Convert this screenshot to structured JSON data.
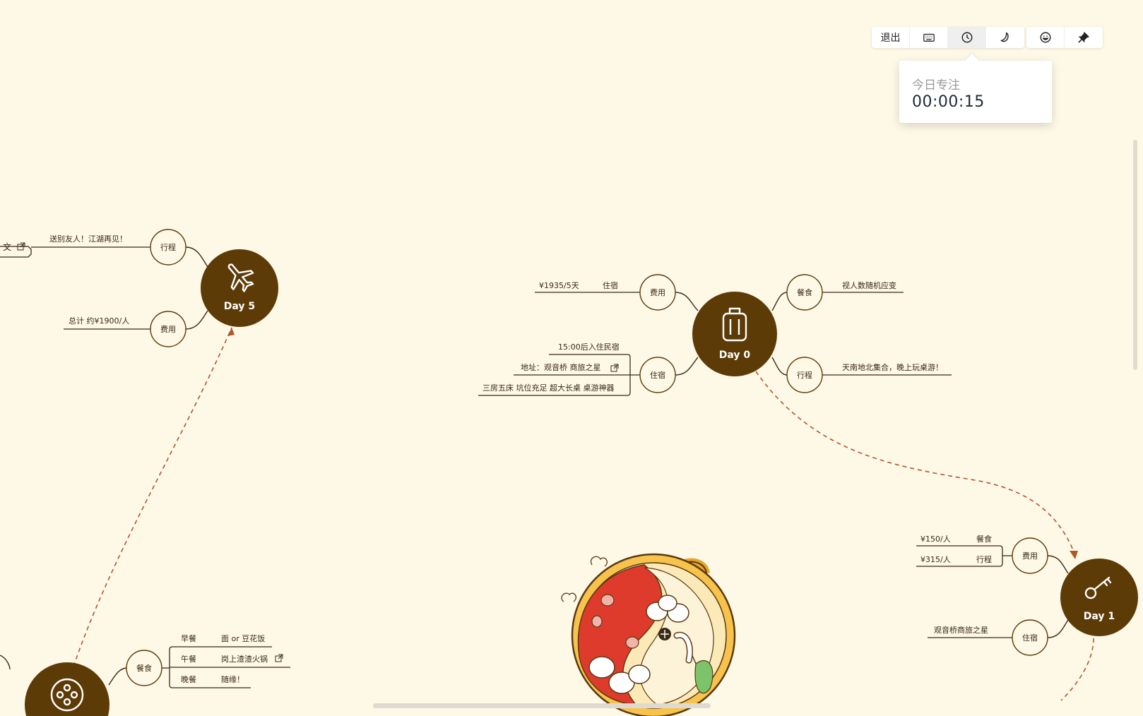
{
  "colors": {
    "accent": "#5c3b07",
    "line": "#3a2a14",
    "dashed": "#b2552b",
    "background": "#fef8e7"
  },
  "toolbar": {
    "exit_label": "退出",
    "keyboard_icon": "keyboard-icon",
    "clock_icon": "clock-icon",
    "moon_icon": "moon-icon",
    "emoji_icon": "emoji-icon",
    "pin_icon": "pin-icon"
  },
  "timer": {
    "label": "今日专注",
    "time": "00:00:15"
  },
  "day0": {
    "title": "Day 0",
    "icon": "suitcase-icon",
    "fee_label": "费用",
    "fee_item_label": "住宿",
    "fee_item_value": "¥1935/5天",
    "stay_label": "住宿",
    "stay_items": [
      "15:00后入住民宿",
      "地址：观音桥 商旅之星",
      "三房五床 坑位充足 超大长桌 桌游神器"
    ],
    "meal_label": "餐食",
    "meal_note": "视人数随机应变",
    "trip_label": "行程",
    "trip_note": "天南地北集合，晚上玩桌游！"
  },
  "day5": {
    "title": "Day 5",
    "icon": "airplane-icon",
    "trip_label": "行程",
    "trip_note": "送别友人！江湖再见！",
    "doc_stub": "文",
    "fee_label": "费用",
    "fee_note": "总计 约¥1900/人"
  },
  "day1": {
    "title": "Day 1",
    "icon": "key-icon",
    "fee_label": "费用",
    "fee_items": [
      {
        "label": "餐食",
        "value": "¥150/人"
      },
      {
        "label": "行程",
        "value": "¥315/人"
      }
    ],
    "stay_label": "住宿",
    "stay_note": "观音桥商旅之星"
  },
  "meal_node": {
    "label": "餐食",
    "icon": "film-reel-icon",
    "rows": [
      {
        "meal": "早餐",
        "food": "面 or 豆花饭"
      },
      {
        "meal": "午餐",
        "food": "岗上渣渣火锅"
      },
      {
        "meal": "晚餐",
        "food": "随缘！"
      }
    ]
  },
  "illustration": "hotpot-illustration"
}
